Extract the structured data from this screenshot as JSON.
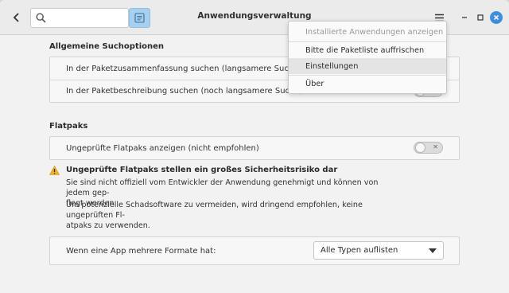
{
  "window": {
    "title": "Anwendungsverwaltung"
  },
  "header": {
    "search": {
      "value": "",
      "placeholder": ""
    }
  },
  "general": {
    "title": "Allgemeine Suchoptionen",
    "rows": [
      {
        "label": "In der Paketzusammenfassung suchen (langsamere Suche)",
        "enabled": false
      },
      {
        "label": "In der Paketbeschreibung suchen (noch langsamere Suche)",
        "enabled": false
      }
    ]
  },
  "flatpaks": {
    "title": "Flatpaks",
    "rows": [
      {
        "label": "Ungeprüfte Flatpaks anzeigen (nicht empfohlen)",
        "enabled": false
      }
    ]
  },
  "warning": {
    "title": "Ungeprüfte Flatpaks stellen ein großes Sicherheitsrisiko dar",
    "para1_line1": "Sie sind nicht offiziell vom Entwickler der Anwendung genehmigt und können von jedem gep-",
    "para1_line2": "flegt werden.",
    "para2_line1": "Um potenzielle Schadsoftware zu vermeiden, wird dringend empfohlen, keine ungeprüften Fl-",
    "para2_line2": "atpaks zu verwenden."
  },
  "formats": {
    "label": "Wenn eine App mehrere Formate hat:",
    "selected": "Alle Typen auflisten"
  },
  "menu": {
    "items": [
      {
        "label": "Installierte Anwendungen anzeigen",
        "enabled": false
      },
      {
        "label": "Bitte die Paketliste auffrischen",
        "enabled": true
      },
      {
        "label": "Einstellungen",
        "enabled": true,
        "highlighted": true
      },
      {
        "label": "Über",
        "enabled": true
      }
    ]
  },
  "colors": {
    "accent": "#3d8ee0",
    "details_button": "#a7cfee",
    "warning": "#f0b323"
  },
  "icons": [
    "back-arrow",
    "search",
    "details-list",
    "hamburger-menu",
    "minimize",
    "maximize",
    "close",
    "warning-triangle",
    "dropdown-arrow"
  ]
}
